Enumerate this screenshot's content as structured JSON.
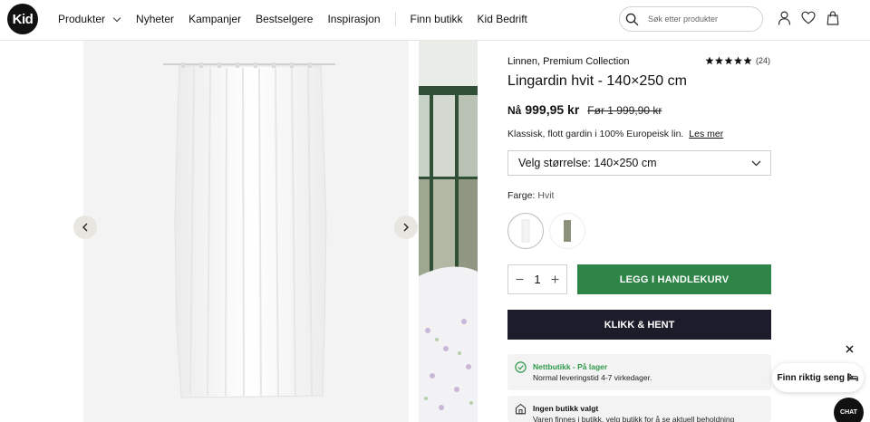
{
  "header": {
    "logo_text": "Kid",
    "nav": [
      {
        "label": "Produkter",
        "has_dropdown": true
      },
      {
        "label": "Nyheter"
      },
      {
        "label": "Kampanjer"
      },
      {
        "label": "Bestselgere"
      },
      {
        "label": "Inspirasjon"
      },
      {
        "label": "Finn butikk"
      },
      {
        "label": "Kid Bedrift"
      }
    ],
    "search_placeholder": "Søk etter produkter"
  },
  "product": {
    "collection": "Linnen, Premium Collection",
    "rating_stars": 5,
    "review_count": "(24)",
    "title": "Lingardin hvit - 140×250 cm",
    "price_prefix": "Nå",
    "price_now": "999,95 kr",
    "price_before": "Før 1 999,90 kr",
    "description": "Klassisk, flott gardin i 100% Europeisk lin.",
    "read_more": "Les mer",
    "size_select": "Velg størrelse: 140×250 cm",
    "color_label": "Farge:",
    "color_value": "Hvit",
    "quantity": "1",
    "add_to_cart": "LEGG I HANDLEKURV",
    "click_collect": "KLIKK & HENT",
    "stock_title": "Nettbutikk - På lager",
    "stock_sub": "Normal leveringstid 4-7 virkedager.",
    "store_title": "Ingen butikk valgt",
    "store_sub": "Varen finnes i butikk, velg butikk for å se aktuell beholdning"
  },
  "chat": {
    "bubble_text": "Finn riktig seng 🛏",
    "button_label": "CHAT"
  },
  "colors": {
    "accent_green": "#2f8548",
    "dark_button": "#1c1c2a",
    "stock_green": "#2f9a4c"
  }
}
